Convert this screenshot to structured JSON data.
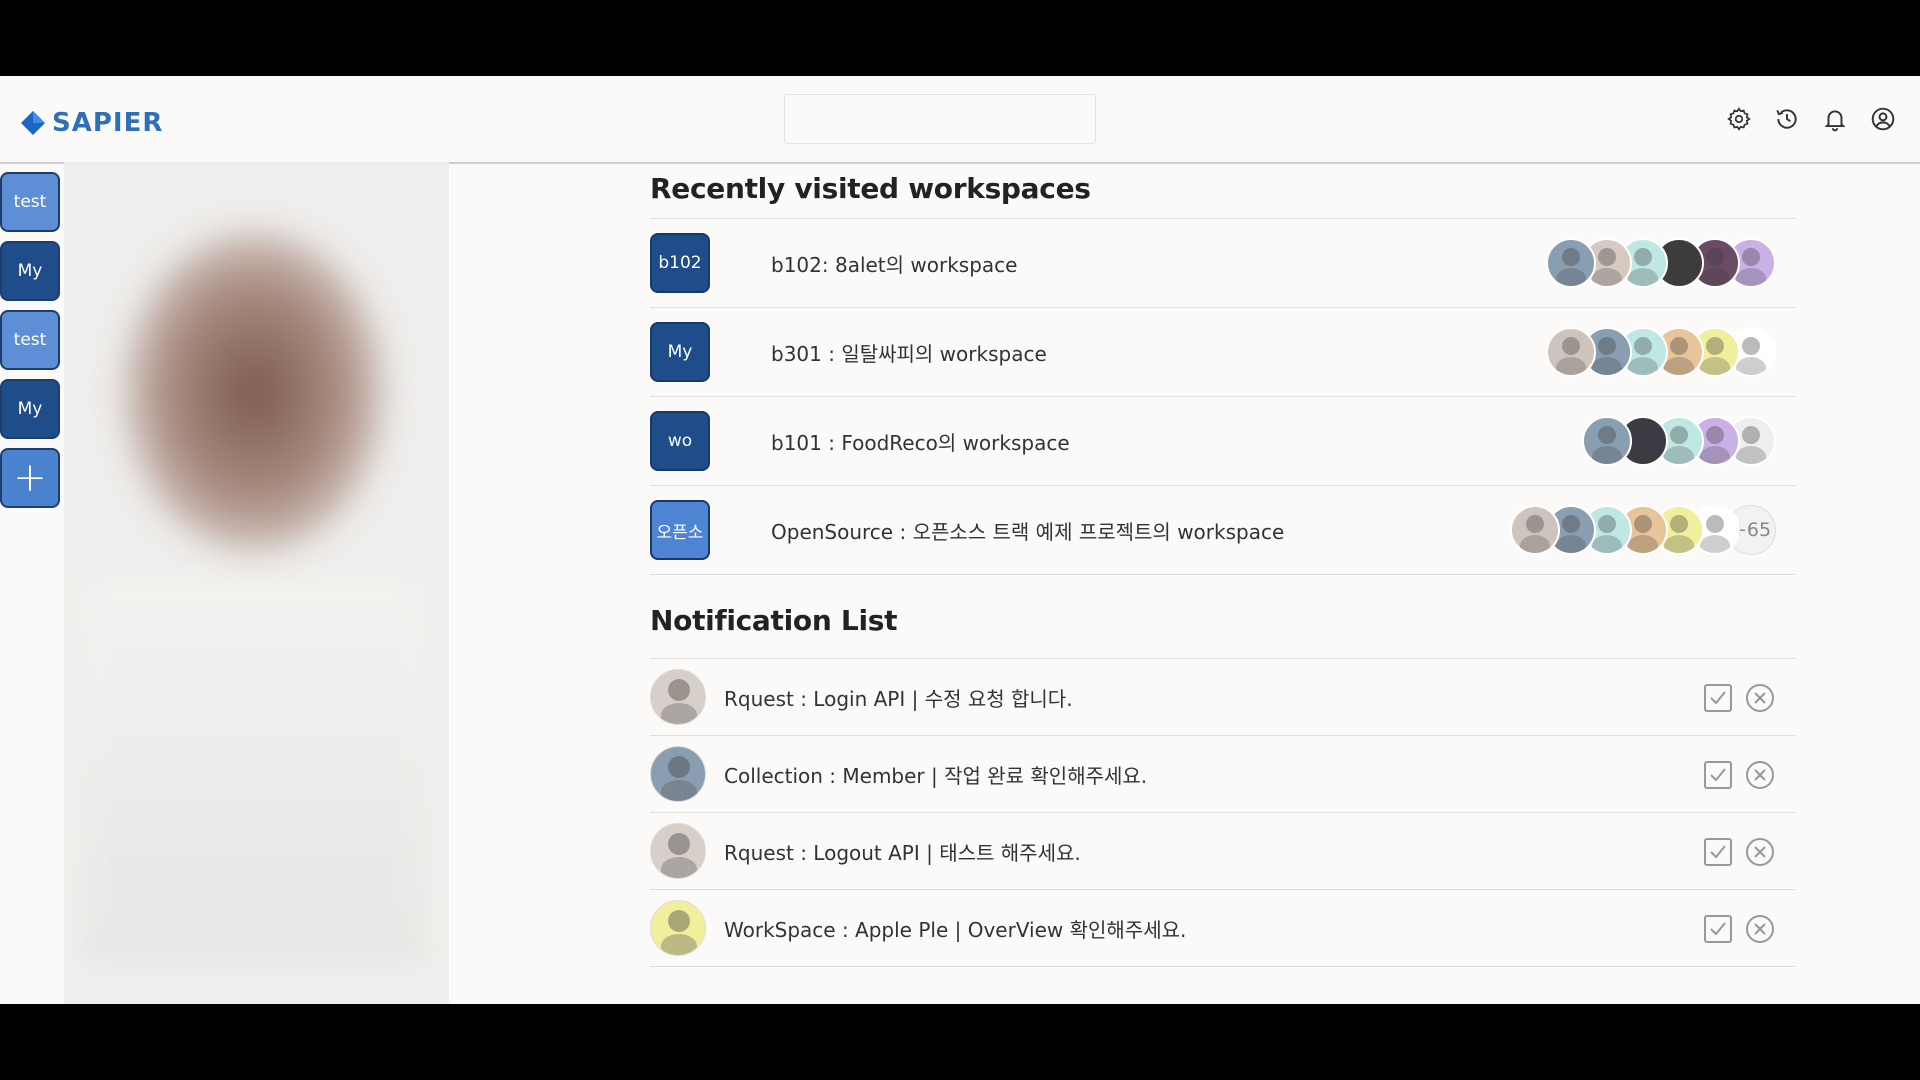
{
  "app": {
    "logo_text": "SAPIER",
    "brand_color": "#2f6fb6"
  },
  "search": {
    "placeholder": ""
  },
  "header_icons": [
    "gear-icon",
    "history-icon",
    "bell-icon",
    "user-circle-icon"
  ],
  "rail": {
    "items": [
      {
        "label": "test",
        "style": "light"
      },
      {
        "label": "My",
        "style": "dark"
      },
      {
        "label": "test",
        "style": "light"
      },
      {
        "label": "My",
        "style": "dark"
      }
    ],
    "add_label": "+"
  },
  "workspaces": {
    "title": "Recently visited workspaces",
    "items": [
      {
        "badge": "b102",
        "badge_style": "dark",
        "name": "b102: 8alet의 workspace",
        "avatar_colors": [
          "#8a9eb1",
          "#d5c9c0",
          "#bfe8e4",
          "#3c3c3c",
          "#6a4b64",
          "#c9b1e6"
        ],
        "more": ""
      },
      {
        "badge": "My",
        "badge_style": "dark",
        "name": "b301 : 일탈싸피의 workspace",
        "avatar_colors": [
          "#cfc4bb",
          "#8a9eb1",
          "#bfe8e4",
          "#e8c49a",
          "#f1ee9c",
          "#ffffff"
        ],
        "more": ""
      },
      {
        "badge": "wo",
        "badge_style": "dark",
        "name": "b101 : FoodReco의 workspace",
        "avatar_colors": [
          "#8a9eb1",
          "#3b3b44",
          "#bfe8e4",
          "#c9b1e6",
          "#eeeeee"
        ],
        "more": ""
      },
      {
        "badge": "오픈소",
        "badge_style": "light",
        "name": "OpenSource : 오픈소스 트랙 예제 프로젝트의 workspace",
        "avatar_colors": [
          "#cfc4bb",
          "#8a9eb1",
          "#bfe8e4",
          "#e8c49a",
          "#f1ee9c",
          "#ffffff"
        ],
        "more": "+65"
      }
    ]
  },
  "notifications": {
    "title": "Notification List",
    "items": [
      {
        "text": "Rquest : Login API | 수정 요청 합니다.",
        "avatar_color": "#d8cfc8"
      },
      {
        "text": "Collection : Member | 작업 완료 확인해주세요.",
        "avatar_color": "#8a9eb1"
      },
      {
        "text": "Rquest : Logout API | 태스트 해주세요.",
        "avatar_color": "#d8cfc8"
      },
      {
        "text": "WorkSpace : Apple Ple | OverView 확인해주세요.",
        "avatar_color": "#f1ee9c"
      }
    ]
  }
}
